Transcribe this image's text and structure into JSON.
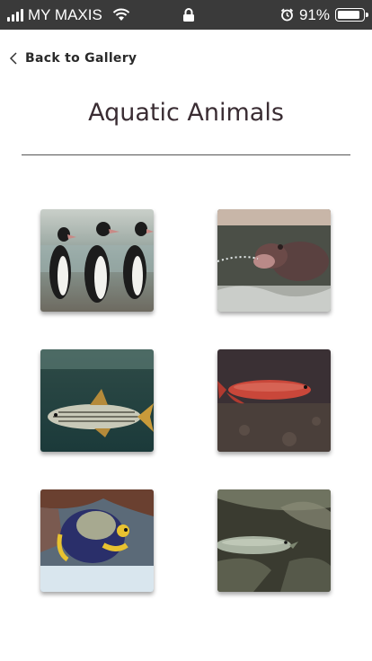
{
  "status_bar": {
    "carrier": "MY MAXIS",
    "battery": "91%",
    "battery_level": 0.91
  },
  "header": {
    "back_label": "Back to Gallery",
    "title": "Aquatic Animals"
  },
  "gallery": {
    "items": [
      {
        "subject": "penguins"
      },
      {
        "subject": "hippo"
      },
      {
        "subject": "striped fish"
      },
      {
        "subject": "red arowana"
      },
      {
        "subject": "angelfish"
      },
      {
        "subject": "silver arowana"
      }
    ]
  }
}
